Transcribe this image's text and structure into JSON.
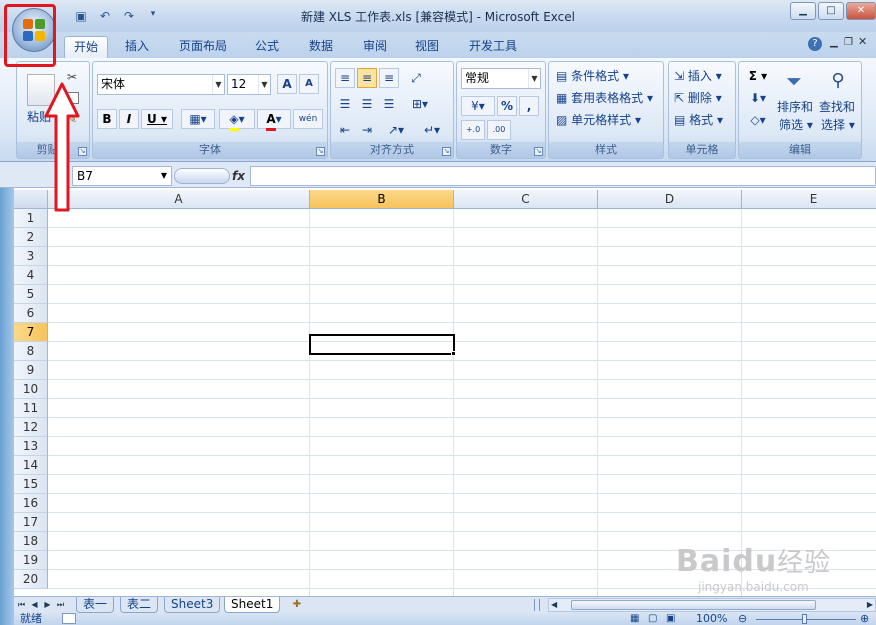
{
  "window": {
    "title": "新建 XLS 工作表.xls  [兼容模式] - Microsoft Excel",
    "minimize": "▁",
    "maximize": "□",
    "close": "✕"
  },
  "qat": {
    "save_icon": "save-icon",
    "undo_icon": "undo-icon",
    "redo_icon": "redo-icon"
  },
  "tabs": [
    "开始",
    "插入",
    "页面布局",
    "公式",
    "数据",
    "审阅",
    "视图",
    "开发工具"
  ],
  "ribbon": {
    "clipboard": {
      "name": "剪贴板",
      "paste": "粘贴"
    },
    "font": {
      "name": "字体",
      "font_name": "宋体",
      "font_size": "12",
      "grow": "A",
      "shrink": "A",
      "bold": "B",
      "italic": "I",
      "underline": "U",
      "wen": "wén"
    },
    "alignment": {
      "name": "对齐方式"
    },
    "number": {
      "name": "数字",
      "format": "常规",
      "percent": "%",
      "comma": ","
    },
    "styles": {
      "name": "样式",
      "conditional": "条件格式",
      "table": "套用表格格式",
      "cell_styles": "单元格样式"
    },
    "cells": {
      "name": "单元格",
      "insert": "插入",
      "delete": "删除",
      "format": "格式"
    },
    "editing": {
      "name": "编辑",
      "sigma": "Σ",
      "sort_filter_1": "排序和",
      "sort_filter_2": "筛选",
      "find_select_1": "查找和",
      "find_select_2": "选择"
    }
  },
  "formula_bar": {
    "name_box": "B7",
    "fx": "fx"
  },
  "grid": {
    "columns": [
      "A",
      "B",
      "C",
      "D",
      "E"
    ],
    "selected_column": "B",
    "rows": [
      "1",
      "2",
      "3",
      "4",
      "5",
      "6",
      "7",
      "8",
      "9",
      "10",
      "11",
      "12",
      "13",
      "14",
      "15",
      "16",
      "17",
      "18",
      "19",
      "20"
    ],
    "selected_row": "7",
    "active_cell": "B7"
  },
  "sheets": [
    "表一",
    "表二",
    "Sheet3",
    "Sheet1"
  ],
  "active_sheet": "Sheet1",
  "status": {
    "ready": "就绪",
    "zoom": "100%"
  },
  "watermark": {
    "brand": "Baidu",
    "suffix": "经验",
    "url": "jingyan.baidu.com"
  },
  "colors": {
    "highlight": "#e0171f",
    "selected_header": "#f8c35a"
  }
}
